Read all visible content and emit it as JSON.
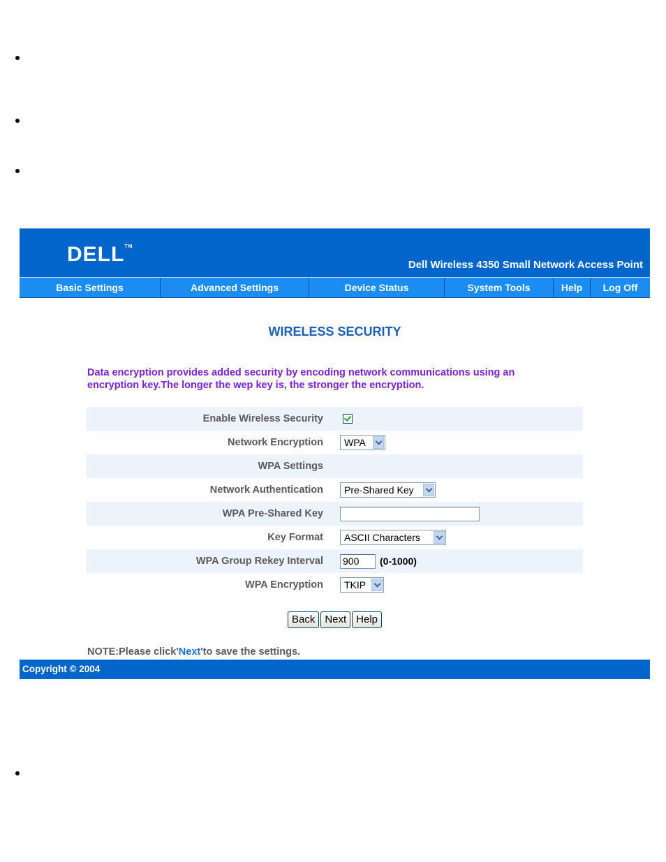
{
  "brand": {
    "logo_text": "DELL",
    "product_name": "Dell Wireless 4350 Small Network Access Point"
  },
  "nav": [
    {
      "label": "Basic Settings"
    },
    {
      "label": "Advanced Settings"
    },
    {
      "label": "Device Status"
    },
    {
      "label": "System Tools"
    },
    {
      "label": "Help"
    },
    {
      "label": "Log Off"
    }
  ],
  "page": {
    "title": "WIRELESS SECURITY",
    "intro": "Data encryption provides added security by encoding network communications using an encryption key.The longer the wep key is, the stronger the encryption."
  },
  "form": {
    "enable_security": {
      "label": "Enable Wireless Security",
      "checked": true
    },
    "network_encryption": {
      "label": "Network Encryption",
      "value": "WPA"
    },
    "wpa_settings_heading": {
      "label": "WPA Settings"
    },
    "network_authentication": {
      "label": "Network Authentication",
      "value": "Pre-Shared Key"
    },
    "wpa_psk": {
      "label": "WPA Pre-Shared Key",
      "value": ""
    },
    "key_format": {
      "label": "Key Format",
      "value": "ASCII Characters"
    },
    "rekey_interval": {
      "label": "WPA Group Rekey Interval",
      "value": "900",
      "hint": "(0-1000)"
    },
    "wpa_encryption": {
      "label": "WPA Encryption",
      "value": "TKIP"
    }
  },
  "buttons": {
    "back": "Back",
    "next": "Next",
    "help": "Help"
  },
  "note": {
    "prefix": "NOTE:Please click'",
    "link": "Next",
    "suffix": "'to save the settings."
  },
  "footer": {
    "copyright": "Copyright © 2004"
  },
  "colors": {
    "header_blue": "#0066cc",
    "nav_blue": "#1b8cf2",
    "title_blue": "#1b5fb8",
    "intro_purple": "#7a1fd6"
  }
}
